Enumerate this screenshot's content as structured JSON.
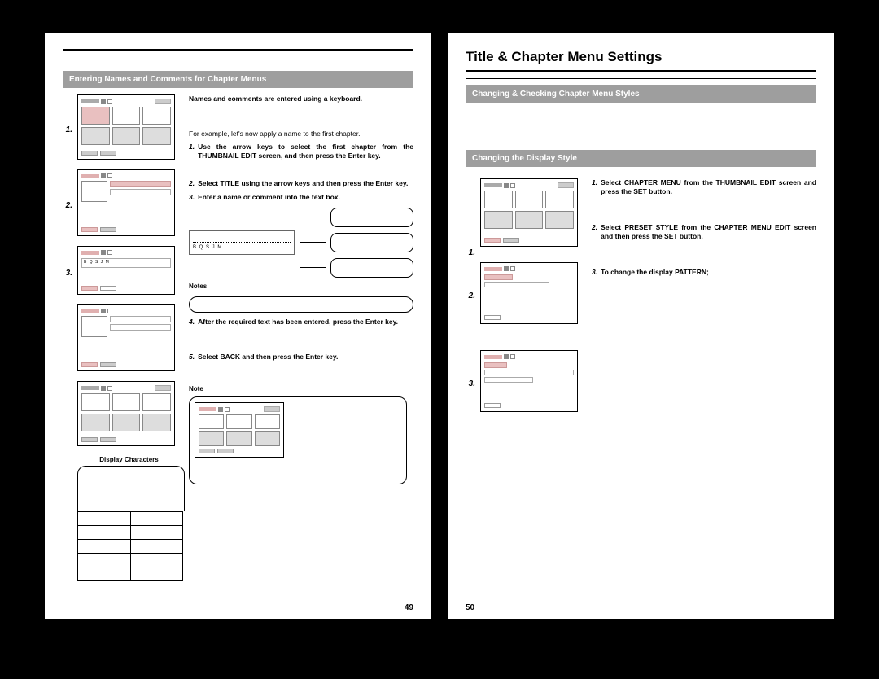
{
  "page_right": {
    "title": "Title & Chapter Menu Settings",
    "section1": "Changing & Checking Chapter Menu Styles",
    "section2": "Changing the Display Style",
    "steps": {
      "s1": "1.",
      "s2": "2.",
      "s3": "3."
    },
    "instr": {
      "i1_num": "1.",
      "i1": "Select CHAPTER MENU from the THUMBNAIL EDIT screen and press the SET button.",
      "i2_num": "2.",
      "i2": "Select PRESET STYLE from the CHAPTER MENU EDIT screen and then press the SET button.",
      "i3_num": "3.",
      "i3": "To change the display PATTERN;"
    },
    "page_num": "50"
  },
  "page_left": {
    "section": "Entering Names and Comments for Chapter Menus",
    "intro": "Names and comments are entered using a keyboard.",
    "example": "For example, let's now apply a name to the first chapter.",
    "steps": {
      "s1": "1.",
      "s2": "2.",
      "s3": "3."
    },
    "instr": {
      "i1_num": "1.",
      "i1": "Use the arrow keys to select the first chapter from the THUMBNAIL EDIT screen, and then press the Enter key.",
      "i2_num": "2.",
      "i2": "Select TITLE using the arrow keys and then press the Enter key.",
      "i3_num": "3.",
      "i3": "Enter a name or comment into the text box.",
      "i4_num": "4.",
      "i4": "After the required text has been entered, press the Enter key.",
      "i5_num": "5.",
      "i5": "Select BACK and then press the Enter key."
    },
    "diagram_text": "B Q S J M",
    "notes_label": "Notes",
    "note_label": "Note",
    "display_chars": "Display Characters",
    "page_num": "49"
  }
}
